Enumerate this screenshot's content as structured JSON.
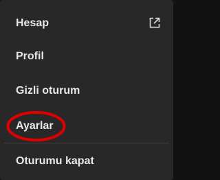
{
  "menu": {
    "items": [
      {
        "label": "Hesap",
        "icon": "external-link-icon"
      },
      {
        "label": "Profil"
      },
      {
        "label": "Gizli oturum"
      },
      {
        "label": "Ayarlar",
        "highlighted": true
      }
    ],
    "footer_item": {
      "label": "Oturumu kapat"
    }
  },
  "colors": {
    "menu_bg": "#282828",
    "text": "#e8e8e8",
    "divider": "#3e3e3e",
    "highlight_ring": "#e00000"
  }
}
